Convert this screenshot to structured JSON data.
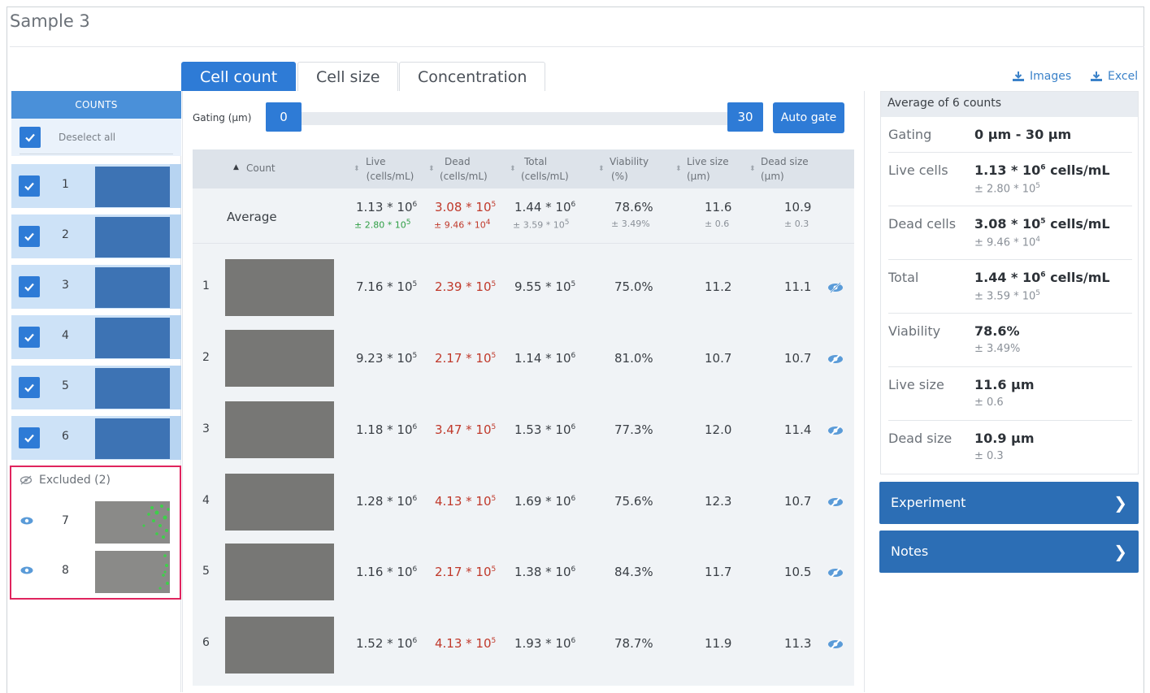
{
  "page": {
    "title": "Sample 3"
  },
  "tabs": [
    {
      "label": "Cell count",
      "active": true
    },
    {
      "label": "Cell size",
      "active": false
    },
    {
      "label": "Concentration",
      "active": false
    }
  ],
  "sidebar": {
    "header": "COUNTS",
    "deselect_label": "Deselect all",
    "counts": [
      {
        "num": "1",
        "checked": true
      },
      {
        "num": "2",
        "checked": true
      },
      {
        "num": "3",
        "checked": true
      },
      {
        "num": "4",
        "checked": true
      },
      {
        "num": "5",
        "checked": true
      },
      {
        "num": "6",
        "checked": true
      }
    ],
    "excluded": {
      "label": "Excluded (2)",
      "items": [
        {
          "num": "7"
        },
        {
          "num": "8"
        }
      ]
    }
  },
  "gating": {
    "label": "Gating (µm)",
    "min": "0",
    "max": "30",
    "autogate_label": "Auto gate"
  },
  "table": {
    "columns": [
      {
        "line1": "Count",
        "line2": ""
      },
      {
        "line1": "Live",
        "line2": "(cells/mL)"
      },
      {
        "line1": "Dead",
        "line2": "(cells/mL)"
      },
      {
        "line1": "Total",
        "line2": "(cells/mL)"
      },
      {
        "line1": "Viability",
        "line2": "(%)"
      },
      {
        "line1": "Live size",
        "line2": "(µm)"
      },
      {
        "line1": "Dead size",
        "line2": "(µm)"
      }
    ],
    "average": {
      "label": "Average",
      "live": {
        "mant": "1.13 * 10",
        "exp": "6",
        "err_mant": "± 2.80 * 10",
        "err_exp": "5"
      },
      "dead": {
        "mant": "3.08 * 10",
        "exp": "5",
        "err_mant": "± 9.46 * 10",
        "err_exp": "4"
      },
      "total": {
        "mant": "1.44 * 10",
        "exp": "6",
        "err_mant": "± 3.59 * 10",
        "err_exp": "5"
      },
      "viability": "78.6%",
      "viability_err": "± 3.49%",
      "live_size": "11.6",
      "live_size_err": "± 0.6",
      "dead_size": "10.9",
      "dead_size_err": "± 0.3"
    },
    "rows": [
      {
        "num": "1",
        "live": "7.16 * 10",
        "live_exp": "5",
        "dead": "2.39 * 10",
        "dead_exp": "5",
        "total": "9.55 * 10",
        "total_exp": "5",
        "viability": "75.0%",
        "live_size": "11.2",
        "dead_size": "11.1"
      },
      {
        "num": "2",
        "live": "9.23 * 10",
        "live_exp": "5",
        "dead": "2.17 * 10",
        "dead_exp": "5",
        "total": "1.14 * 10",
        "total_exp": "6",
        "viability": "81.0%",
        "live_size": "10.7",
        "dead_size": "10.7"
      },
      {
        "num": "3",
        "live": "1.18 * 10",
        "live_exp": "6",
        "dead": "3.47 * 10",
        "dead_exp": "5",
        "total": "1.53 * 10",
        "total_exp": "6",
        "viability": "77.3%",
        "live_size": "12.0",
        "dead_size": "11.4"
      },
      {
        "num": "4",
        "live": "1.28 * 10",
        "live_exp": "6",
        "dead": "4.13 * 10",
        "dead_exp": "5",
        "total": "1.69 * 10",
        "total_exp": "6",
        "viability": "75.6%",
        "live_size": "12.3",
        "dead_size": "10.7"
      },
      {
        "num": "5",
        "live": "1.16 * 10",
        "live_exp": "6",
        "dead": "2.17 * 10",
        "dead_exp": "5",
        "total": "1.38 * 10",
        "total_exp": "6",
        "viability": "84.3%",
        "live_size": "11.7",
        "dead_size": "10.5"
      },
      {
        "num": "6",
        "live": "1.52 * 10",
        "live_exp": "6",
        "dead": "4.13 * 10",
        "dead_exp": "5",
        "total": "1.93 * 10",
        "total_exp": "6",
        "viability": "78.7%",
        "live_size": "11.9",
        "dead_size": "11.3"
      }
    ]
  },
  "downloads": {
    "images_label": "Images",
    "excel_label": "Excel"
  },
  "summary": {
    "header": "Average of 6 counts",
    "gating": {
      "label": "Gating",
      "value": "0 µm - 30 µm"
    },
    "live": {
      "label": "Live cells",
      "mant": "1.13 * 10",
      "exp": "6",
      "unit": " cells/mL",
      "err_mant": "± 2.80 * 10",
      "err_exp": "5"
    },
    "dead": {
      "label": "Dead cells",
      "mant": "3.08 * 10",
      "exp": "5",
      "unit": " cells/mL",
      "err_mant": "± 9.46 * 10",
      "err_exp": "4"
    },
    "total": {
      "label": "Total",
      "mant": "1.44 * 10",
      "exp": "6",
      "unit": " cells/mL",
      "err_mant": "± 3.59 * 10",
      "err_exp": "5"
    },
    "viability": {
      "label": "Viability",
      "value": "78.6%",
      "err": "± 3.49%"
    },
    "live_size": {
      "label": "Live size",
      "value": "11.6 µm",
      "err": "± 0.6"
    },
    "dead_size": {
      "label": "Dead size",
      "value": "10.9 µm",
      "err": "± 0.3"
    }
  },
  "panels": {
    "experiment_label": "Experiment",
    "notes_label": "Notes"
  },
  "colors": {
    "accent": "#2e7bd6",
    "live": "#2e9e44",
    "dead": "#c0392b",
    "excluded_border": "#e0245e"
  }
}
